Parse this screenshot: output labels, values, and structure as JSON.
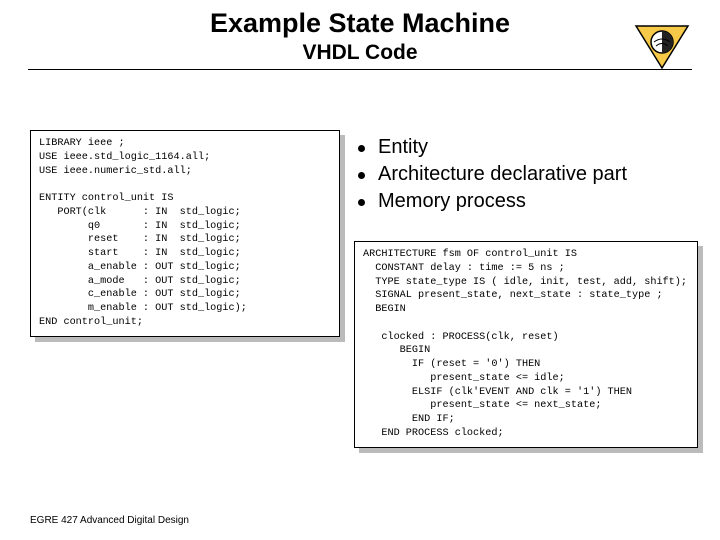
{
  "header": {
    "title": "Example State Machine",
    "subtitle": "VHDL Code"
  },
  "codeblock1": "LIBRARY ieee ;\nUSE ieee.std_logic_1164.all;\nUSE ieee.numeric_std.all;\n\nENTITY control_unit IS\n   PORT(clk      : IN  std_logic;\n        q0       : IN  std_logic;\n        reset    : IN  std_logic;\n        start    : IN  std_logic;\n        a_enable : OUT std_logic;\n        a_mode   : OUT std_logic;\n        c_enable : OUT std_logic;\n        m_enable : OUT std_logic);\nEND control_unit;",
  "bullets": {
    "item1": "Entity",
    "item2": "Architecture declarative part",
    "item3": "Memory process"
  },
  "codeblock2": "ARCHITECTURE fsm OF control_unit IS\n  CONSTANT delay : time := 5 ns ;\n  TYPE state_type IS ( idle, init, test, add, shift);\n  SIGNAL present_state, next_state : state_type ;\n  BEGIN\n\n   clocked : PROCESS(clk, reset)\n      BEGIN\n        IF (reset = '0') THEN\n           present_state <= idle;\n        ELSIF (clk'EVENT AND clk = '1') THEN\n           present_state <= next_state;\n        END IF;\n   END PROCESS clocked;",
  "footer": "EGRE 427 Advanced Digital Design"
}
